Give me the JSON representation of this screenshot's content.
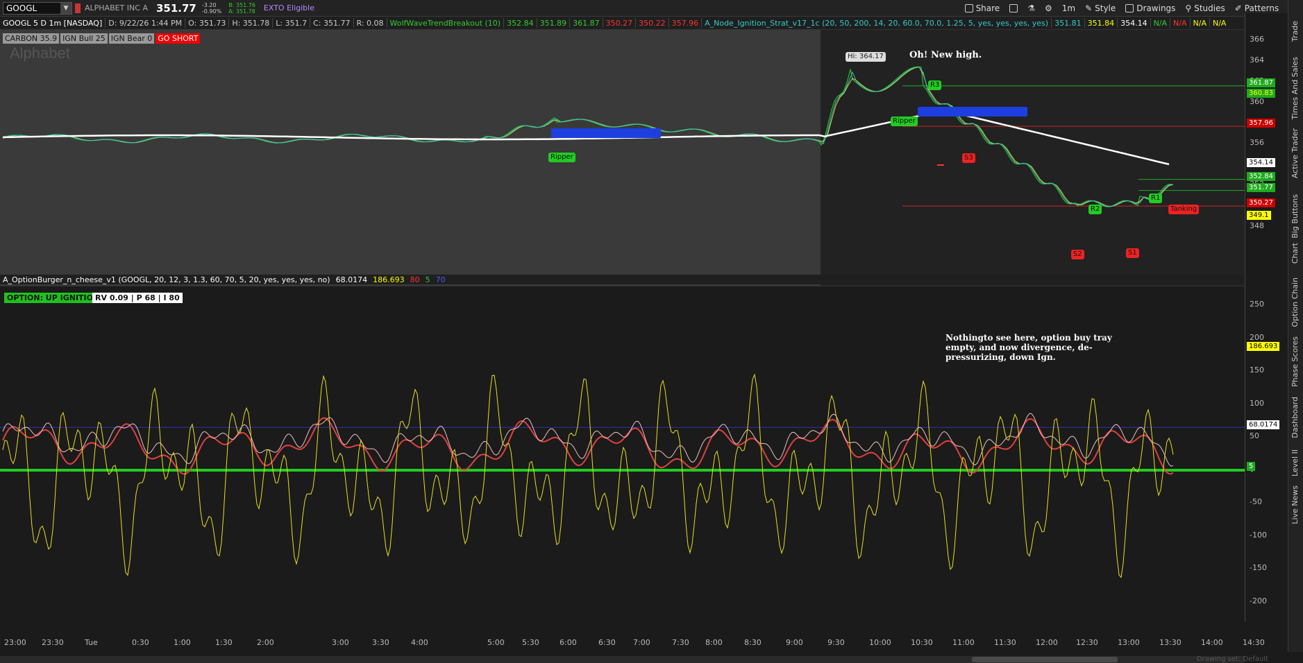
{
  "topbar": {
    "symbol": "GOOGL",
    "company": "ALPHABET INC A",
    "last": "351.77",
    "change": "-3.20",
    "change_pct": "-0.90%",
    "bid": "B: 351.76",
    "ask": "A: 351.78",
    "exto": "EXTO Eligible",
    "tools": {
      "share": "Share",
      "style": "Style",
      "drawings": "Drawings",
      "studies": "Studies",
      "patterns": "Patterns",
      "interval": "1m"
    }
  },
  "chart_header": {
    "title": "GOOGL 5 D 1m [NASDAQ]",
    "date": "D: 9/22/26 1:44 PM",
    "open": "O: 351.73",
    "high": "H: 351.78",
    "low": "L: 351.7",
    "close": "C: 351.77",
    "range": "R: 0.08",
    "study1_name": "WolfWaveTrendBreakout (10)",
    "study1_vals": [
      "352.84",
      "351.89",
      "361.87",
      "350.27",
      "350.22",
      "357.96"
    ],
    "study2_name": "A_Node_Ignition_Strat_v17_1c (20, 50, 200, 14, 20, 60.0, 70.0, 1.25, 5, yes, yes, yes, yes)",
    "study2_vals": [
      "351.81",
      "351.84",
      "354.14",
      "N/A",
      "N/A",
      "N/A",
      "N/A"
    ]
  },
  "upper_labels": [
    "CARBON 35.9",
    "IGN Bull 25",
    "IGN Bear 0",
    "GO SHORT"
  ],
  "watermark": "Alphabet",
  "annotations": {
    "hi": "Hi: 364.17",
    "new_high": "Oh! New high.",
    "lower_note": "Nothingto see here, option buy tray empty, and now divergence, de-pressurizing, down Ign.",
    "ripper1": "Ripper",
    "ripper2": "Ripper",
    "r3": "R3",
    "r2": "R2",
    "r1": "R1",
    "s3": "S3",
    "s2": "S2",
    "s1": "S1",
    "tanking": "Tanking"
  },
  "price_scale": {
    "ticks": [
      "366",
      "364",
      "362",
      "360",
      "358",
      "356",
      "354",
      "352",
      "350",
      "348"
    ],
    "tags": [
      {
        "v": "361.87",
        "bg": "#1faa1f",
        "fg": "#ffffff"
      },
      {
        "v": "360.83",
        "bg": "#1faa1f",
        "fg": "#ffff00"
      },
      {
        "v": "357.96",
        "bg": "#cc0000",
        "fg": "#ffffff"
      },
      {
        "v": "354.14",
        "bg": "#ffffff",
        "fg": "#000000"
      },
      {
        "v": "352.84",
        "bg": "#1faa1f",
        "fg": "#ffffff"
      },
      {
        "v": "351.77",
        "bg": "#1faa1f",
        "fg": "#ffffff"
      },
      {
        "v": "350.27",
        "bg": "#cc0000",
        "fg": "#ffffff"
      },
      {
        "v": "349.1",
        "bg": "#ffff00",
        "fg": "#000000"
      }
    ]
  },
  "lower_header": {
    "study": "A_OptionBurger_n_cheese_v1 (GOOGL, 20, 12, 3, 1.3, 60, 70, 5, 20, yes, yes, yes, no)",
    "vals": [
      "68.0174",
      "186.693",
      "80",
      "5",
      "70"
    ]
  },
  "lower_badges": {
    "ignition": "OPTION: UP IGNITION",
    "rv": "RV 0.09 | P 68 | I 80"
  },
  "lower_scale": {
    "ticks": [
      "250",
      "200",
      "150",
      "100",
      "50",
      "0",
      "-50",
      "-100",
      "-150",
      "-200"
    ],
    "tags": [
      {
        "v": "186.693",
        "bg": "#ffff00",
        "fg": "#000000"
      },
      {
        "v": "68.0174",
        "bg": "#ffffff",
        "fg": "#000000"
      },
      {
        "v": "5",
        "bg": "#1faa1f",
        "fg": "#ffffff"
      }
    ]
  },
  "time_axis": [
    "23:00",
    "23:30",
    "Tue",
    "0:30",
    "1:00",
    "1:30",
    "2:00",
    "3:00",
    "3:30",
    "4:00",
    "5:00",
    "5:30",
    "6:00",
    "6:30",
    "7:00",
    "7:30",
    "8:00",
    "8:30",
    "9:00",
    "9:30",
    "10:00",
    "10:30",
    "11:00",
    "11:30",
    "12:00",
    "12:30",
    "13:00",
    "13:30",
    "14:00",
    "14:30"
  ],
  "drawing_set": "Drawing set: Default",
  "sidebar": [
    "Trade",
    "Times And Sales",
    "Active Trader",
    "Big Buttons",
    "Chart",
    "Option Chain",
    "Phase Scores",
    "Dashboard",
    "Level II",
    "Live News"
  ]
}
